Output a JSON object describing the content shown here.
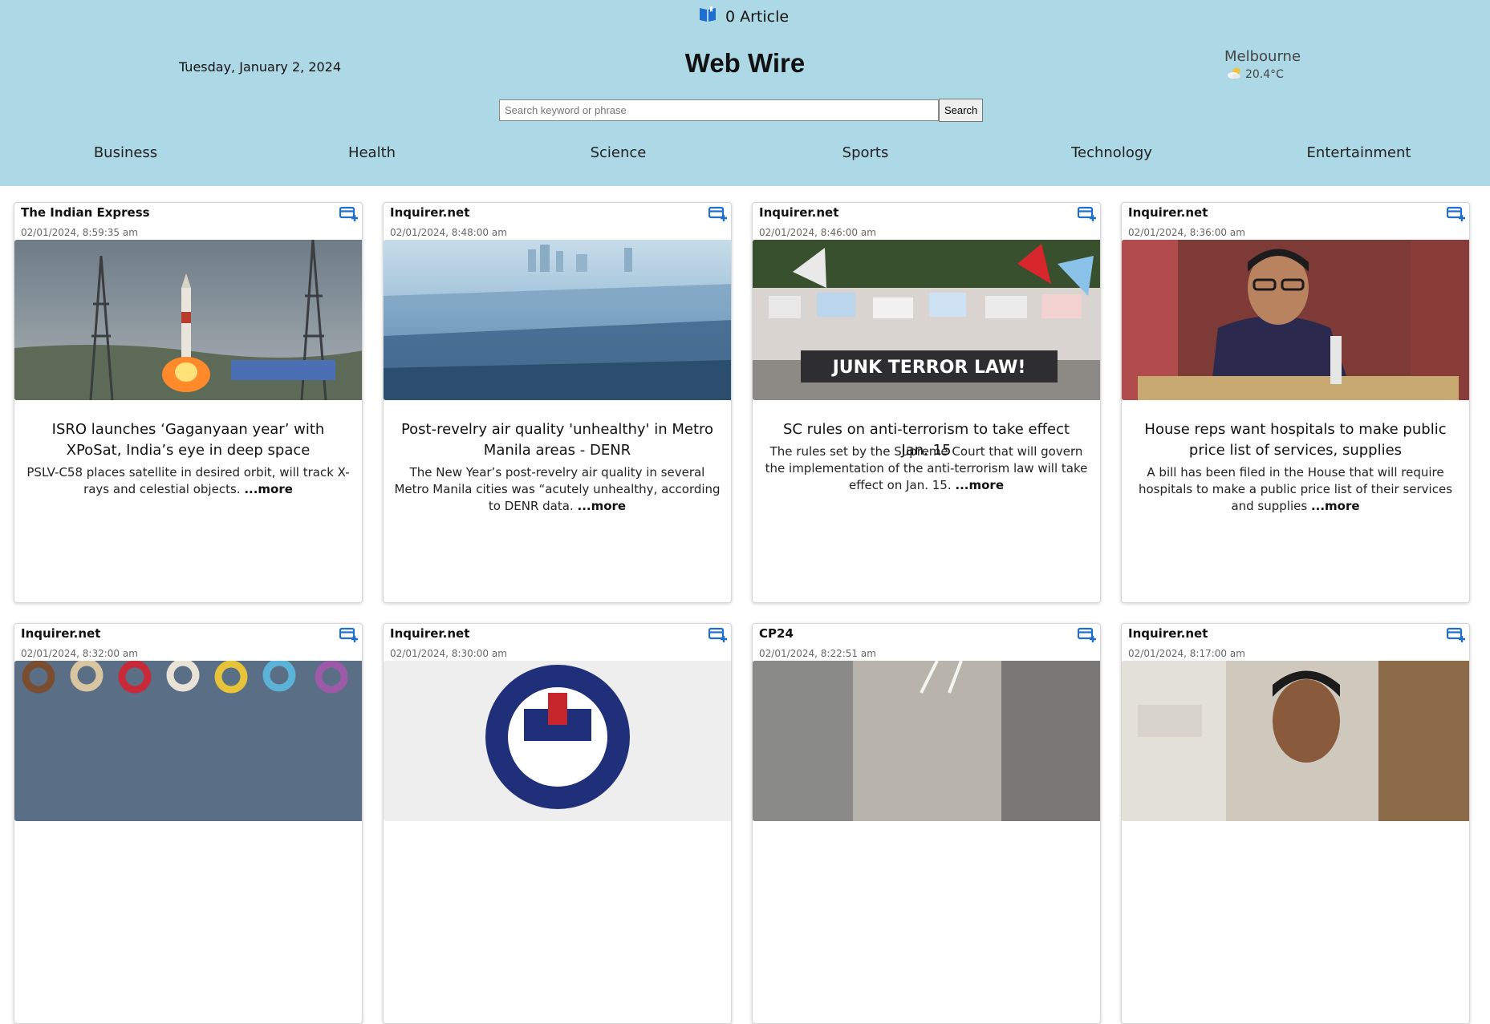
{
  "header": {
    "saved_count": "0 Article",
    "date": "Tuesday, January 2, 2024",
    "site_title": "Web Wire",
    "weather": {
      "city": "Melbourne",
      "temperature": "20.4°C",
      "icon": "partly-cloudy-icon"
    },
    "search": {
      "placeholder": "Search keyword or phrase",
      "value": "",
      "button_label": "Search"
    },
    "nav": [
      "Business",
      "Health",
      "Science",
      "Sports",
      "Technology",
      "Entertainment"
    ]
  },
  "articles": [
    {
      "source": "The Indian Express",
      "time": "02/01/2024, 8:59:35 am",
      "title": "ISRO launches ‘Gaganyaan year’ with XPoSat, India’s eye in deep space",
      "summary": "PSLV-C58 places satellite in desired orbit, will track X-rays and celestial objects.",
      "more_label": "...more",
      "image": "rocket-launch"
    },
    {
      "source": "Inquirer.net",
      "time": "02/01/2024, 8:48:00 am",
      "title": "Post-revelry air quality 'unhealthy' in Metro Manila areas - DENR",
      "summary": "The New Year’s post-revelry air quality in several Metro Manila cities was “acutely unhealthy, according to DENR data.",
      "more_label": "...more",
      "image": "hazy-city"
    },
    {
      "source": "Inquirer.net",
      "time": "02/01/2024, 8:46:00 am",
      "title": "SC rules on anti-terrorism to take effect Jan. 15",
      "summary": "The rules set by the Supreme Court that will govern the implementation of the anti-terrorism law will take effect on Jan. 15.",
      "more_label": "...more",
      "image": "protest-march",
      "image_banner": "JUNK TERROR LAW!"
    },
    {
      "source": "Inquirer.net",
      "time": "02/01/2024, 8:36:00 am",
      "title": "House reps want hospitals to make public price list of services, supplies",
      "summary": "A bill has been filed in the House that will require hospitals to make a public price list of their services and supplies",
      "more_label": "...more",
      "image": "lawmaker-at-hearing"
    },
    {
      "source": "Inquirer.net",
      "time": "02/01/2024, 8:32:00 am",
      "image": "beaded-bracelets"
    },
    {
      "source": "Inquirer.net",
      "time": "02/01/2024, 8:30:00 am",
      "image": "government-seal"
    },
    {
      "source": "CP24",
      "time": "02/01/2024, 8:22:51 am",
      "image": "crowded-hallway"
    },
    {
      "source": "Inquirer.net",
      "time": "02/01/2024, 8:17:00 am",
      "image": "man-portrait"
    }
  ],
  "colors": {
    "header_bg": "#add8e6",
    "accent_icon": "#1e6fd0"
  }
}
